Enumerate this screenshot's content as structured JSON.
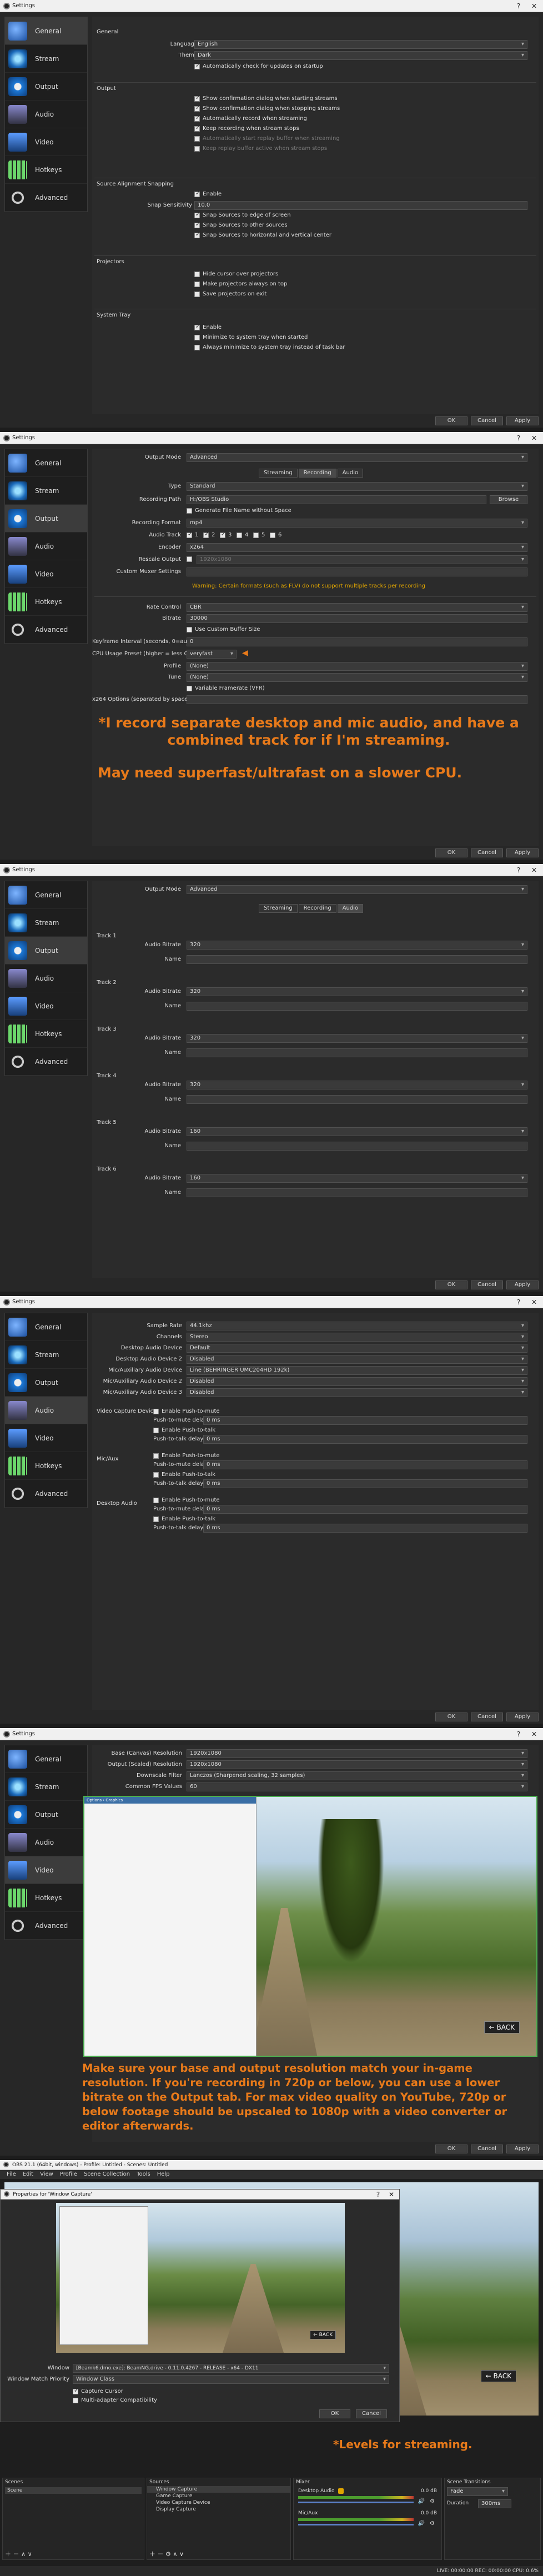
{
  "window_title": "Settings",
  "nav": [
    "General",
    "Stream",
    "Output",
    "Audio",
    "Video",
    "Hotkeys",
    "Advanced"
  ],
  "general": {
    "group_general": "General",
    "language_label": "Language",
    "language": "English",
    "theme_label": "Theme",
    "theme": "Dark",
    "auto_update": "Automatically check for updates on startup",
    "group_output": "Output",
    "out_opts": [
      "Show confirmation dialog when starting streams",
      "Show confirmation dialog when stopping streams",
      "Automatically record when streaming",
      "Keep recording when stream stops",
      "Automatically start replay buffer when streaming",
      "Keep replay buffer active when stream stops"
    ],
    "group_snap": "Source Alignment Snapping",
    "snap_enable": "Enable",
    "snap_sens_label": "Snap Sensitivity",
    "snap_sens": "10.0",
    "snap_opts": [
      "Snap Sources to edge of screen",
      "Snap Sources to other sources",
      "Snap Sources to horizontal and vertical center"
    ],
    "group_proj": "Projectors",
    "proj_opts": [
      "Hide cursor over projectors",
      "Make projectors always on top",
      "Save projectors on exit"
    ],
    "group_tray": "System Tray",
    "tray_opts": [
      "Enable",
      "Minimize to system tray when started",
      "Always minimize to system tray instead of task bar"
    ]
  },
  "buttons": {
    "ok": "OK",
    "cancel": "Cancel",
    "apply": "Apply"
  },
  "output_rec": {
    "mode_label": "Output Mode",
    "mode": "Advanced",
    "tabs": [
      "Streaming",
      "Recording",
      "Audio"
    ],
    "type_label": "Type",
    "type": "Standard",
    "path_label": "Recording Path",
    "path": "H:/OBS Studio",
    "browse": "Browse",
    "nospace": "Generate File Name without Space",
    "format_label": "Recording Format",
    "format": "mp4",
    "track_label": "Audio Track",
    "tracks": [
      "1",
      "2",
      "3",
      "4",
      "5",
      "6"
    ],
    "encoder_label": "Encoder",
    "encoder": "x264",
    "rescale_label": "Rescale Output",
    "rescale": "1920x1080",
    "muxer_label": "Custom Muxer Settings",
    "warning": "Warning: Certain formats (such as FLV) do not support multiple tracks per recording",
    "rc_label": "Rate Control",
    "rc": "CBR",
    "bitrate_label": "Bitrate",
    "bitrate": "30000",
    "custom_buffer": "Use Custom Buffer Size",
    "kf_label": "Keyframe Interval (seconds, 0=auto)",
    "kf": "0",
    "cpu_label": "CPU Usage Preset (higher = less CPU)",
    "cpu": "veryfast",
    "profile_label": "Profile",
    "profile": "(None)",
    "tune_label": "Tune",
    "tune": "(None)",
    "vfr": "Variable Framerate (VFR)",
    "x264_label": "x264 Options (separated by space)",
    "note1": "*I record separate desktop and mic audio, and have a combined track for if I'm streaming.",
    "note2": "May need superfast/ultrafast on a slower CPU."
  },
  "output_audio": {
    "tracks": [
      "Track 1",
      "Track 2",
      "Track 3",
      "Track 4",
      "Track 5",
      "Track 6"
    ],
    "bitrate_label": "Audio Bitrate",
    "bitrates": [
      "320",
      "320",
      "320",
      "320",
      "160",
      "160"
    ],
    "name_label": "Name"
  },
  "audio": {
    "rows": [
      [
        "Sample Rate",
        "44.1khz"
      ],
      [
        "Channels",
        "Stereo"
      ],
      [
        "Desktop Audio Device",
        "Default"
      ],
      [
        "Desktop Audio Device 2",
        "Disabled"
      ],
      [
        "Mic/Auxiliary Audio Device",
        "Line (BEHRINGER UMC204HD 192k)"
      ],
      [
        "Mic/Auxiliary Audio Device 2",
        "Disabled"
      ],
      [
        "Mic/Auxiliary Audio Device 3",
        "Disabled"
      ]
    ],
    "groups": [
      "Video Capture Device",
      "Mic/Aux",
      "Desktop Audio"
    ],
    "push_mute": "Enable Push-to-mute",
    "mute_delay": "Push-to-mute delay",
    "push_talk": "Enable Push-to-talk",
    "talk_delay": "Push-to-talk delay",
    "ms": "0 ms"
  },
  "video": {
    "rows": [
      [
        "Base (Canvas) Resolution",
        "1920x1080"
      ],
      [
        "Output (Scaled) Resolution",
        "1920x1080"
      ],
      [
        "Downscale Filter",
        "Lanczos (Sharpened scaling, 32 samples)"
      ],
      [
        "Common FPS Values",
        "60"
      ]
    ],
    "back": "← BACK",
    "note": "Make sure your base and output resolution match your in-game resolution. If you're recording in 720p or below, you can use a lower bitrate on the Output tab. For max video quality on YouTube, 720p or below footage should be upscaled to 1080p with a video converter or editor afterwards."
  },
  "obs": {
    "title": "OBS 21.1 (64bit, windows) - Profile: Untitled - Scenes: Untitled",
    "menu": [
      "File",
      "Edit",
      "View",
      "Profile",
      "Scene Collection",
      "Tools",
      "Help"
    ],
    "dialog_title": "Properties for 'Window Capture'",
    "window_label": "Window",
    "window_value": "[Beamk6.dmo.exe]: BeamNG.drive - 0.11.0.4267 - RELEASE - x64 - DX11",
    "match_label": "Window Match Priority",
    "match_value": "Window Class",
    "capture_cursor": "Capture Cursor",
    "multi_adapter": "Multi-adapter Compatibility",
    "scenes_title": "Scenes",
    "sources_title": "Sources",
    "mixer_title": "Mixer",
    "transitions_title": "Scene Transitions",
    "scene": "Scene",
    "sources": [
      "Window Capture",
      "Game Capture",
      "Video Capture Device",
      "Display Capture"
    ],
    "mixer": [
      [
        "Desktop Audio",
        "0.0 dB"
      ],
      [
        "Mic/Aux",
        "0.0 dB"
      ]
    ],
    "transition": "Fade",
    "duration_label": "Duration",
    "duration": "300ms",
    "status": "LIVE: 00:00:00   REC: 00:00:00   CPU: 0.6%",
    "levels_note": "*Levels for streaming."
  }
}
